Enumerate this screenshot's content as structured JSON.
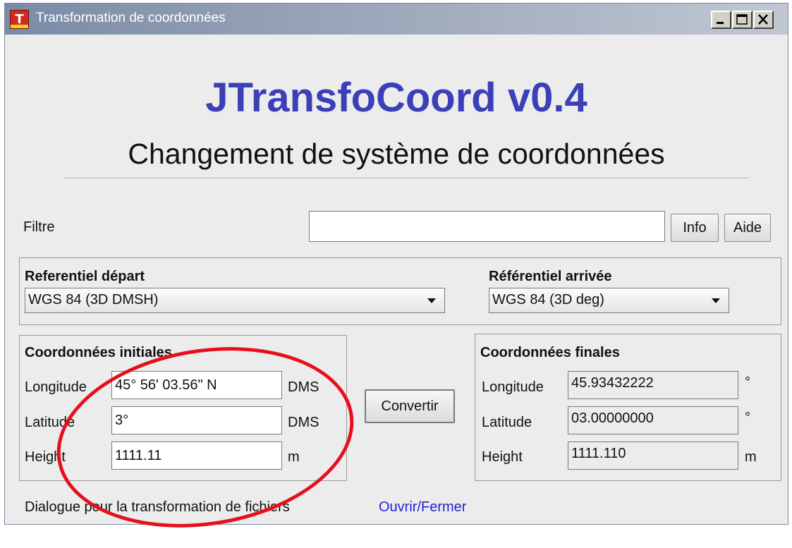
{
  "window": {
    "title": "Transformation de coordonnées",
    "icon_letter": "T",
    "buttons": [
      "minimize-icon",
      "maximize-icon",
      "close-icon"
    ]
  },
  "header": {
    "app_title": "JTransfoCoord v0.4",
    "subtitle": "Changement de système de coordonnées"
  },
  "filter": {
    "label": "Filtre",
    "value": "",
    "info_label": "Info",
    "aide_label": "Aide"
  },
  "referentials": {
    "depart_label": "Referentiel départ",
    "depart_value": "WGS 84 (3D DMSH)",
    "arrivee_label": "Référentiel arrivée",
    "arrivee_value": "WGS 84 (3D deg)"
  },
  "initial": {
    "title": "Coordonnées initiales",
    "rows": [
      {
        "label": "Longitude",
        "value": "45° 56' 03.56\" N",
        "unit": "DMS"
      },
      {
        "label": "Latitude",
        "value": "3°",
        "unit": "DMS"
      },
      {
        "label": "Height",
        "value": "1111.11",
        "unit": "m"
      }
    ]
  },
  "convert_label": "Convertir",
  "final": {
    "title": "Coordonnées finales",
    "rows": [
      {
        "label": "Longitude",
        "value": "45.93432222",
        "unit": "°"
      },
      {
        "label": "Latitude",
        "value": "03.00000000",
        "unit": "°"
      },
      {
        "label": "Height",
        "value": "1111.110",
        "unit": "m"
      }
    ]
  },
  "footer": {
    "text": "Dialogue pour la transformation de fichiers",
    "link": "Ouvrir/Fermer"
  },
  "colors": {
    "title_blue": "#3b3fb8",
    "link_blue": "#1f1fd8",
    "annotation_red": "#e5101c"
  }
}
